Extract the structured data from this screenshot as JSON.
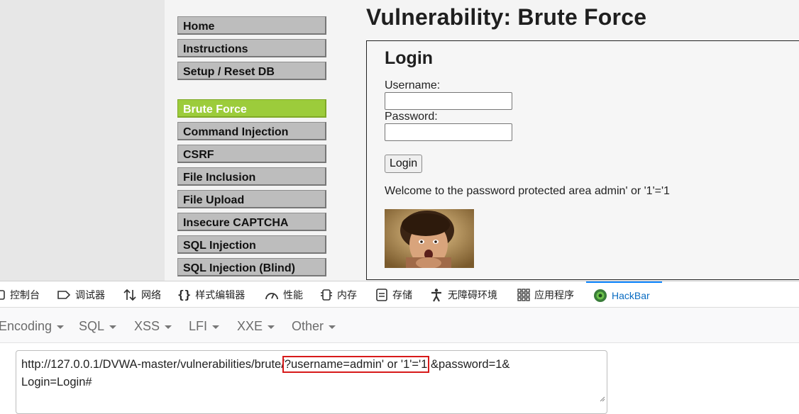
{
  "menu": {
    "items": [
      {
        "label": "Home"
      },
      {
        "label": "Instructions"
      },
      {
        "label": "Setup / Reset DB"
      },
      {
        "label": "Brute Force",
        "selected": true
      },
      {
        "label": "Command Injection"
      },
      {
        "label": "CSRF"
      },
      {
        "label": "File Inclusion"
      },
      {
        "label": "File Upload"
      },
      {
        "label": "Insecure CAPTCHA"
      },
      {
        "label": "SQL Injection"
      },
      {
        "label": "SQL Injection (Blind)"
      }
    ],
    "selected_color": "#9ccc3b"
  },
  "page": {
    "title": "Vulnerability: Brute Force",
    "login": {
      "heading": "Login",
      "username_label": "Username:",
      "password_label": "Password:",
      "username_value": "",
      "password_value": "",
      "button_label": "Login",
      "welcome_text": "Welcome to the password protected area admin' or '1'='1"
    }
  },
  "devtools": {
    "tabs": [
      {
        "label": "控制台",
        "icon": "console-icon"
      },
      {
        "label": "调试器",
        "icon": "debugger-icon"
      },
      {
        "label": "网络",
        "icon": "network-icon"
      },
      {
        "label": "样式编辑器",
        "icon": "braces-icon"
      },
      {
        "label": "性能",
        "icon": "gauge-icon"
      },
      {
        "label": "内存",
        "icon": "memory-icon"
      },
      {
        "label": "存储",
        "icon": "storage-icon"
      },
      {
        "label": "无障碍环境",
        "icon": "accessibility-icon"
      },
      {
        "label": "应用程序",
        "icon": "grid-icon"
      },
      {
        "label": "HackBar",
        "icon": "hackbar-logo-icon",
        "active": true
      }
    ],
    "active_color": "#0a84ff"
  },
  "hackbar": {
    "menus": [
      "Encoding",
      "SQL",
      "XSS",
      "LFI",
      "XXE",
      "Other"
    ],
    "url": {
      "prefix": "http://127.0.0.1/DVWA-master/vulnerabilities/brute/",
      "highlighted": "?username=admin' or '1'='1",
      "suffix": "&password=1&",
      "line2": "Login=Login#"
    },
    "highlight_color": "#d71a1a"
  }
}
